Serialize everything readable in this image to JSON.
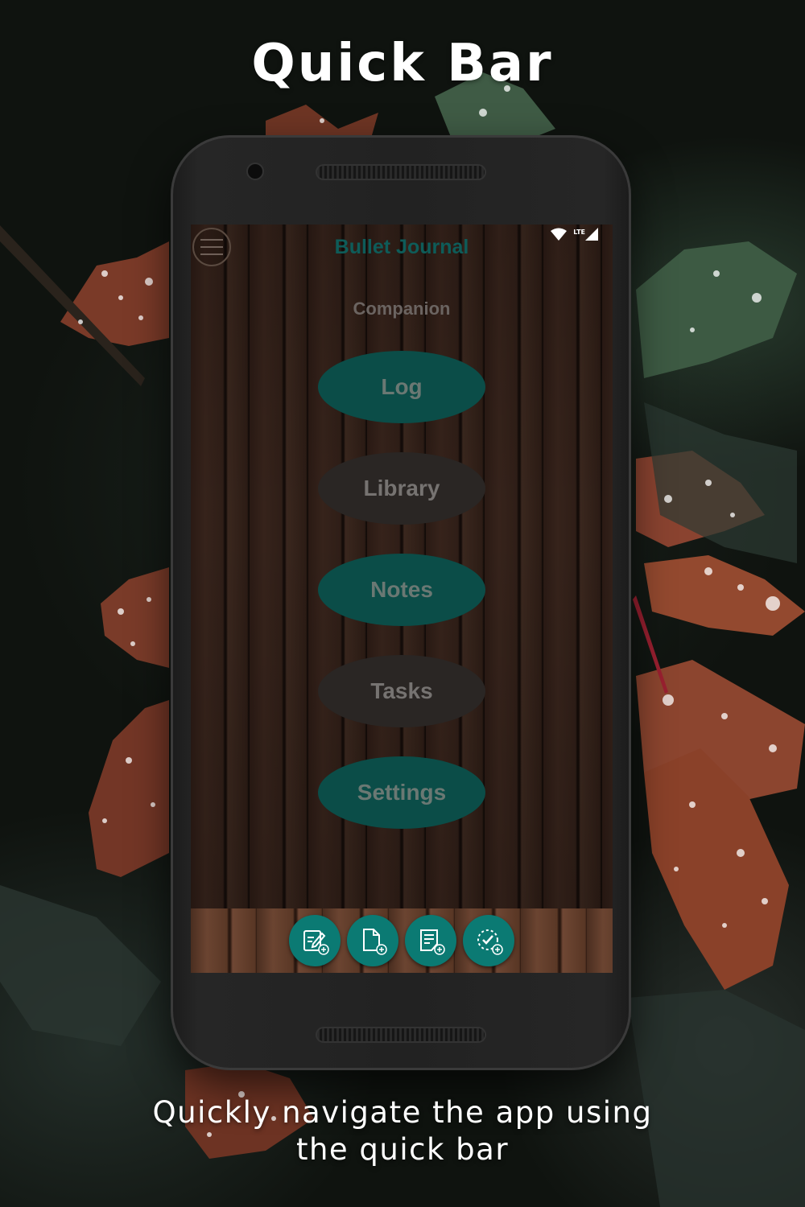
{
  "promo": {
    "headline": "Quick Bar",
    "caption_line1": "Quickly navigate the app using",
    "caption_line2": "the quick bar"
  },
  "status_bar": {
    "network_label": "LTE",
    "icons": [
      "wifi-icon",
      "signal-icon"
    ]
  },
  "app": {
    "title": "Bullet Journal",
    "subtitle": "Companion",
    "menu_icon": "hamburger-menu-icon"
  },
  "main_menu": [
    {
      "label": "Log",
      "style": "teal"
    },
    {
      "label": "Library",
      "style": "dark"
    },
    {
      "label": "Notes",
      "style": "teal"
    },
    {
      "label": "Tasks",
      "style": "dark"
    },
    {
      "label": "Settings",
      "style": "teal"
    }
  ],
  "quick_bar": [
    {
      "icon": "new-log-entry-icon"
    },
    {
      "icon": "new-page-icon"
    },
    {
      "icon": "new-note-icon"
    },
    {
      "icon": "new-task-icon"
    }
  ],
  "colors": {
    "teal_accent": "#0b7a73",
    "title_teal": "#0e5c59",
    "menu_teal": "#0b4d48",
    "menu_dark": "#2a2624"
  }
}
